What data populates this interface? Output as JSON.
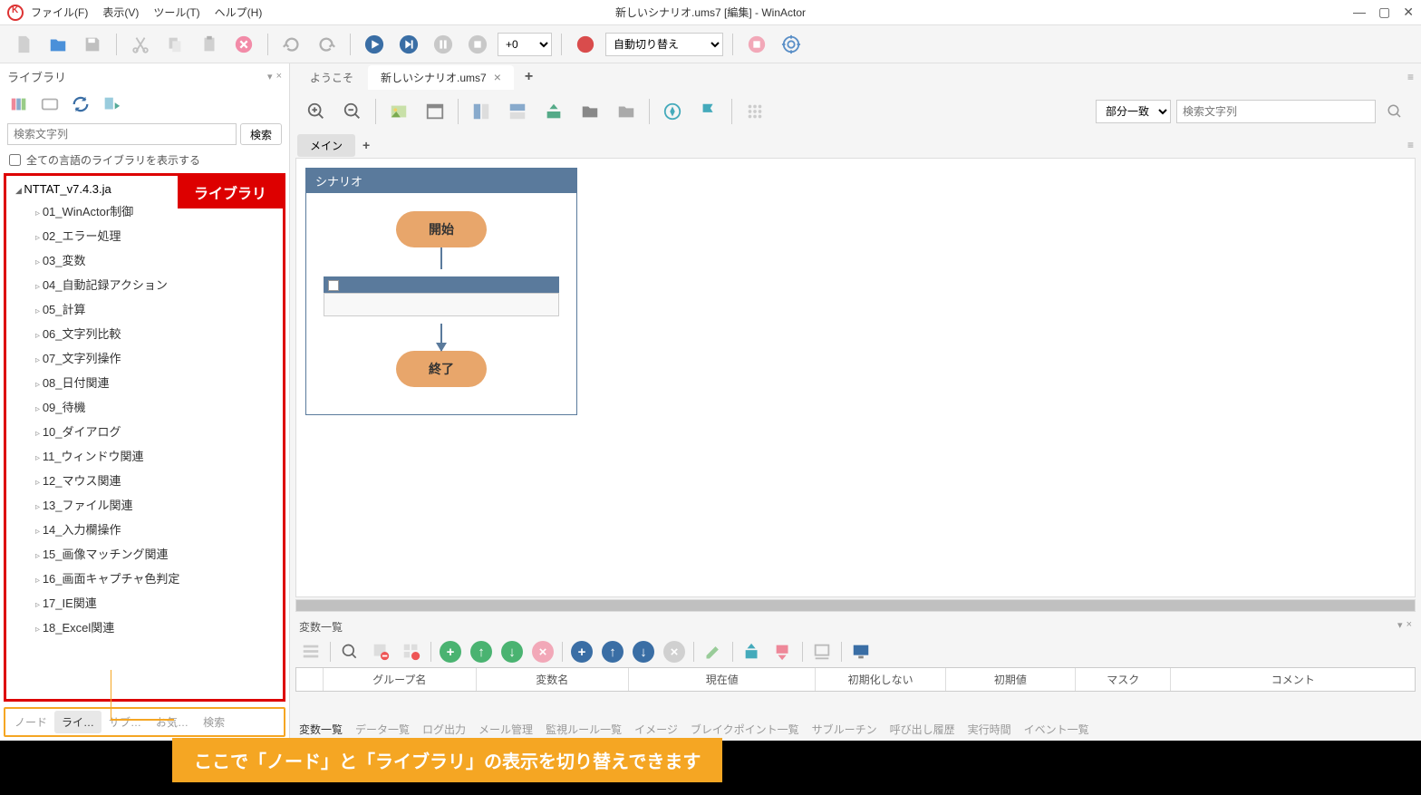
{
  "window": {
    "title": "新しいシナリオ.ums7 [編集] - WinActor"
  },
  "menu": {
    "file": "ファイル(F)",
    "view": "表示(V)",
    "tool": "ツール(T)",
    "help": "ヘルプ(H)"
  },
  "toolbar": {
    "speed_value": "+0",
    "mode_value": "自動切り替え"
  },
  "sidebar": {
    "title": "ライブラリ",
    "search_placeholder": "検索文字列",
    "search_btn": "検索",
    "show_all_langs": "全ての言語のライブラリを表示する",
    "badge": "ライブラリ",
    "tree_root": "NTTAT_v7.4.3.ja",
    "tree_items": [
      "01_WinActor制御",
      "02_エラー処理",
      "03_変数",
      "04_自動記録アクション",
      "05_計算",
      "06_文字列比較",
      "07_文字列操作",
      "08_日付関連",
      "09_待機",
      "10_ダイアログ",
      "11_ウィンドウ関連",
      "12_マウス関連",
      "13_ファイル関連",
      "14_入力欄操作",
      "15_画像マッチング関連",
      "16_画面キャプチャ色判定",
      "17_IE関連",
      "18_Excel関連"
    ],
    "tabs": {
      "node": "ノード",
      "lib": "ライ…",
      "sub": "サブ…",
      "fav": "お気…",
      "search": "検索"
    }
  },
  "doc_tabs": {
    "welcome": "ようこそ",
    "scenario": "新しいシナリオ.ums7"
  },
  "content_tools": {
    "match_mode": "部分一致",
    "search_placeholder": "検索文字列"
  },
  "sub_tabs": {
    "main": "メイン"
  },
  "canvas": {
    "scenario_title": "シナリオ",
    "start": "開始",
    "end": "終了"
  },
  "var_panel": {
    "title": "変数一覧",
    "cols": {
      "group": "グループ名",
      "name": "変数名",
      "current": "現在値",
      "noinit": "初期化しない",
      "initial": "初期値",
      "mask": "マスク",
      "comment": "コメント"
    }
  },
  "bottom_tabs": {
    "vars": "変数一覧",
    "data": "データ一覧",
    "log": "ログ出力",
    "mail": "メール管理",
    "monitor": "監視ルール一覧",
    "image": "イメージ",
    "breakpoint": "ブレイクポイント一覧",
    "subroutine": "サブルーチン",
    "callhistory": "呼び出し履歴",
    "exectime": "実行時間",
    "events": "イベント一覧"
  },
  "annotation": {
    "text": "ここで「ノード」と「ライブラリ」の表示を切り替えできます"
  }
}
